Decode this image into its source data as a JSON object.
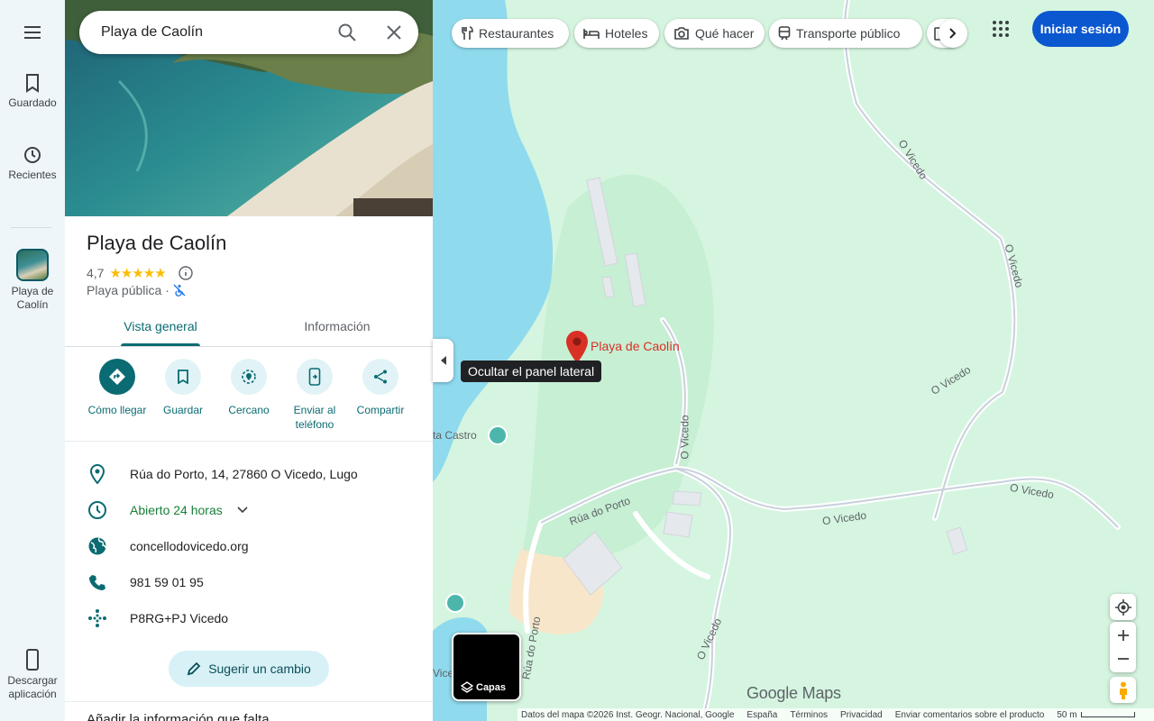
{
  "rail": {
    "menu_label": "",
    "saved_label": "Guardado",
    "recents_label": "Recientes",
    "place_label": "Playa de Caolín",
    "download_label": "Descargar aplicación"
  },
  "search": {
    "value": "Playa de Caolín"
  },
  "place": {
    "title": "Playa de Caolín",
    "rating": "4,7",
    "category": "Playa pública",
    "tabs": [
      "Vista general",
      "Información"
    ],
    "actions": [
      "Cómo llegar",
      "Guardar",
      "Cercano",
      "Enviar al teléfono",
      "Compartir"
    ],
    "address": "Rúa do Porto, 14, 27860 O Vicedo, Lugo",
    "hours": "Abierto 24 horas",
    "website": "concellodovicedo.org",
    "phone": "981 59 01 95",
    "plus_code": "P8RG+PJ Vicedo",
    "suggest_label": "Sugerir un cambio",
    "add_info": "Añadir la información que falta"
  },
  "map": {
    "chips": [
      "Restaurantes",
      "Hoteles",
      "Qué hacer",
      "Transporte público"
    ],
    "signin_label": "Iniciar sesión",
    "collapse_tooltip": "Ocultar el panel lateral",
    "pin_label": "Playa de Caolín",
    "poi_label": "ta Castro",
    "poi_label_2": "Vice",
    "road_labels": [
      "O Vicedo",
      "O Vicedo",
      "O Vicedo",
      "O Vicedo",
      "O Vicedo",
      "O Vicedo",
      "O Vicedo",
      "Rúa do Porto",
      "Rúa do Porto"
    ],
    "layers_label": "Capas",
    "logo_text": "Google Maps",
    "footer": {
      "data": "Datos del mapa ©2026 Inst. Geogr. Nacional, Google",
      "country": "España",
      "terms": "Términos",
      "privacy": "Privacidad",
      "feedback": "Enviar comentarios sobre el producto",
      "scale": "50 m"
    }
  },
  "colors": {
    "accent": "#0b6b72",
    "brand_blue": "#0b57d0",
    "pin": "#d93025",
    "open": "#188038",
    "water": "#90daee",
    "land": "#d5f5e0"
  }
}
